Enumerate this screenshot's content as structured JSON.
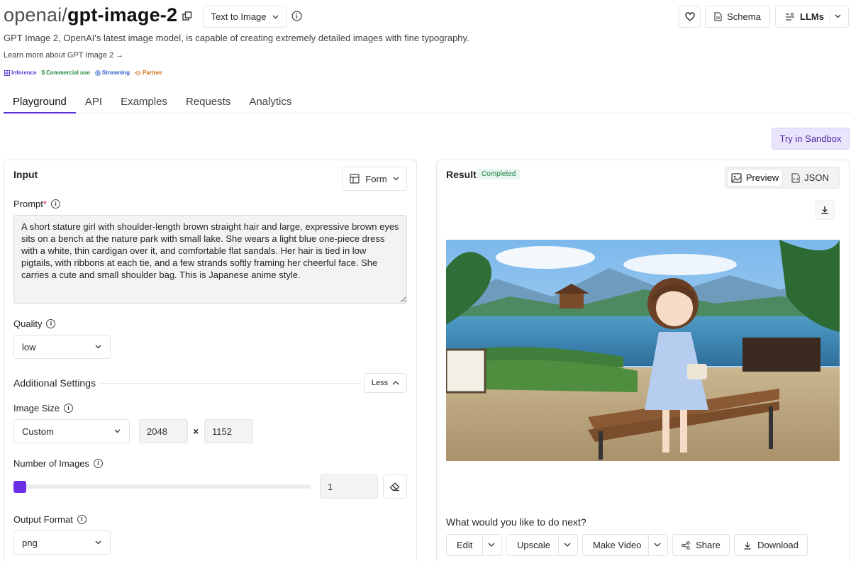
{
  "header": {
    "owner": "openai/",
    "model": "gpt-image-2",
    "mode_select": "Text to Image",
    "description": "GPT Image 2, OpenAI's latest image model, is capable of creating extremely detailed images with fine typography.",
    "learn_more": "Learn more about GPT Image 2 →",
    "schema_label": "Schema",
    "llms_label": "LLMs",
    "badges": [
      {
        "label": "Inference",
        "color": "#5b3fd6"
      },
      {
        "label": "Commercial use",
        "color": "#1f8a3c"
      },
      {
        "label": "Streaming",
        "color": "#2a5fd0"
      },
      {
        "label": "Partner",
        "color": "#d16b12"
      }
    ]
  },
  "tabs": [
    "Playground",
    "API",
    "Examples",
    "Requests",
    "Analytics"
  ],
  "sandbox_label": "Try in Sandbox",
  "input": {
    "title": "Input",
    "form_label": "Form",
    "prompt_label": "Prompt",
    "required_mark": "*",
    "prompt_value": "A short stature girl with shoulder-length brown straight hair and large, expressive brown eyes sits on a bench at the nature park with small lake. She wears a light blue one-piece dress with a white, thin cardigan over it, and comfortable flat sandals. Her hair is tied in low pigtails, with ribbons at each tie, and a few strands softly framing her cheerful face. She carries a cute and small shoulder bag. This is Japanese anime style.",
    "quality_label": "Quality",
    "quality_value": "low",
    "additional_settings": "Additional Settings",
    "less_label": "Less",
    "image_size_label": "Image Size",
    "image_size_value": "Custom",
    "width_value": "2048",
    "times": "×",
    "height_value": "1152",
    "num_images_label": "Number of Images",
    "num_images_value": "1",
    "output_format_label": "Output Format",
    "output_format_value": "png"
  },
  "result": {
    "title": "Result",
    "status": "Completed",
    "preview_label": "Preview",
    "json_label": "JSON",
    "next_prompt": "What would you like to do next?",
    "actions": {
      "edit": "Edit",
      "upscale": "Upscale",
      "make_video": "Make Video",
      "share": "Share",
      "download": "Download"
    }
  },
  "colors": {
    "accent": "#6b2fe6",
    "tab_underline": "#5b2fd6",
    "sandbox_bg": "#e9e3fb",
    "completed_bg": "#e8f6ee",
    "completed_text": "#1e7d45"
  }
}
